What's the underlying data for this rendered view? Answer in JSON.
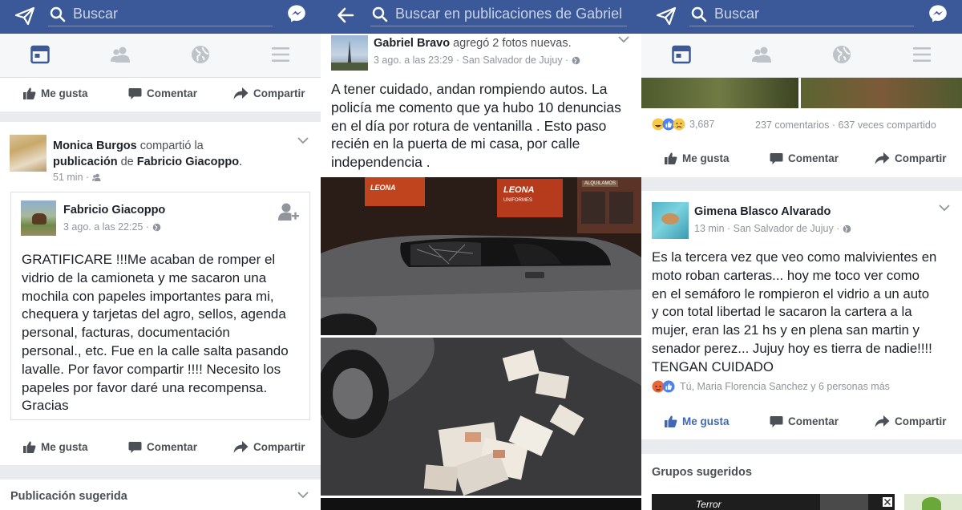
{
  "colors": {
    "brand": "#3b5998",
    "link": "#4267b2",
    "muted": "#90949c"
  },
  "search": {
    "placeholder_main": "Buscar",
    "placeholder_profile": "Buscar en publicaciones de Gabriel"
  },
  "actions": {
    "like": "Me gusta",
    "comment": "Comentar",
    "share": "Compartir"
  },
  "icons": {
    "left_feed": "paper-plane-icon",
    "left_profile": "back-arrow-icon",
    "right": "messenger-icon",
    "nav": [
      "news-feed-icon",
      "friends-icon",
      "globe-icon",
      "menu-icon"
    ]
  },
  "panel1": {
    "shared": {
      "author": "Monica Burgos",
      "action_1": " compartió la",
      "action_2": "publicación",
      "action_3": " de ",
      "original_author": "Fabricio Giacoppo",
      "period": ".",
      "time": "51 min",
      "separator": " · "
    },
    "inner": {
      "author": "Fabricio Giacoppo",
      "meta": "3 ago. a las 22:25 · ",
      "lines": [
        "GRATIFICARE !!!Me acaban de romper el",
        "vidrio de la camioneta y me sacaron una",
        "mochila con papeles importantes para mi,",
        "chequera y tarjetas del agro, sellos, agenda",
        "personal, facturas, documentación",
        "personal., etc. Fue en la calle salta pasando",
        "lavalle. Por favor compartir !!!! Necesito los",
        "papeles por favor daré  una recompensa.",
        "Gracias"
      ]
    },
    "suggested": "Publicación sugerida"
  },
  "panel2": {
    "author": "Gabriel Bravo",
    "action": " agregó 2 fotos nuevas.",
    "meta": "3 ago. a las 23:29 · San Salvador de Jujuy · ",
    "lines": [
      "A tener cuidado, andan rompiendo autos. La",
      "policía me comento que ya hubo 10 denuncias",
      "en el día por rotura de ventanilla .  Esto paso",
      "recién en la puerta de mi casa, por calle",
      "independencia ."
    ],
    "sign1": "LEONA",
    "sign2": "LEONA",
    "sign2_sub": "UNIFORMES",
    "sign3": "ALQUILAMOS",
    "sign4": "LEONA"
  },
  "panel3": {
    "reaction_count": "3,687",
    "stats": "237 comentarios · 637 veces compartido",
    "author": "Gimena Blasco Alvarado",
    "meta": "13 min · San Salvador de Jujuy · ",
    "lines": [
      "Es la tercera vez que veo como malvivientes en",
      "moto roban carteras... hoy me toco ver como",
      "en el semáforo le rompieron el vidrio a un auto",
      "y con total libertad le sacaron la cartera a la",
      "mujer, eran las 21 hs y en plena san martin y",
      "senador perez... Jujuy hoy es tierra de nadie!!!!",
      "TENGAN CUIDADO"
    ],
    "reactors": "Tú, Maria Florencia Sanchez y 6 personas más",
    "groups_title": "Grupos sugeridos",
    "group_thumb_text": "Terror"
  }
}
